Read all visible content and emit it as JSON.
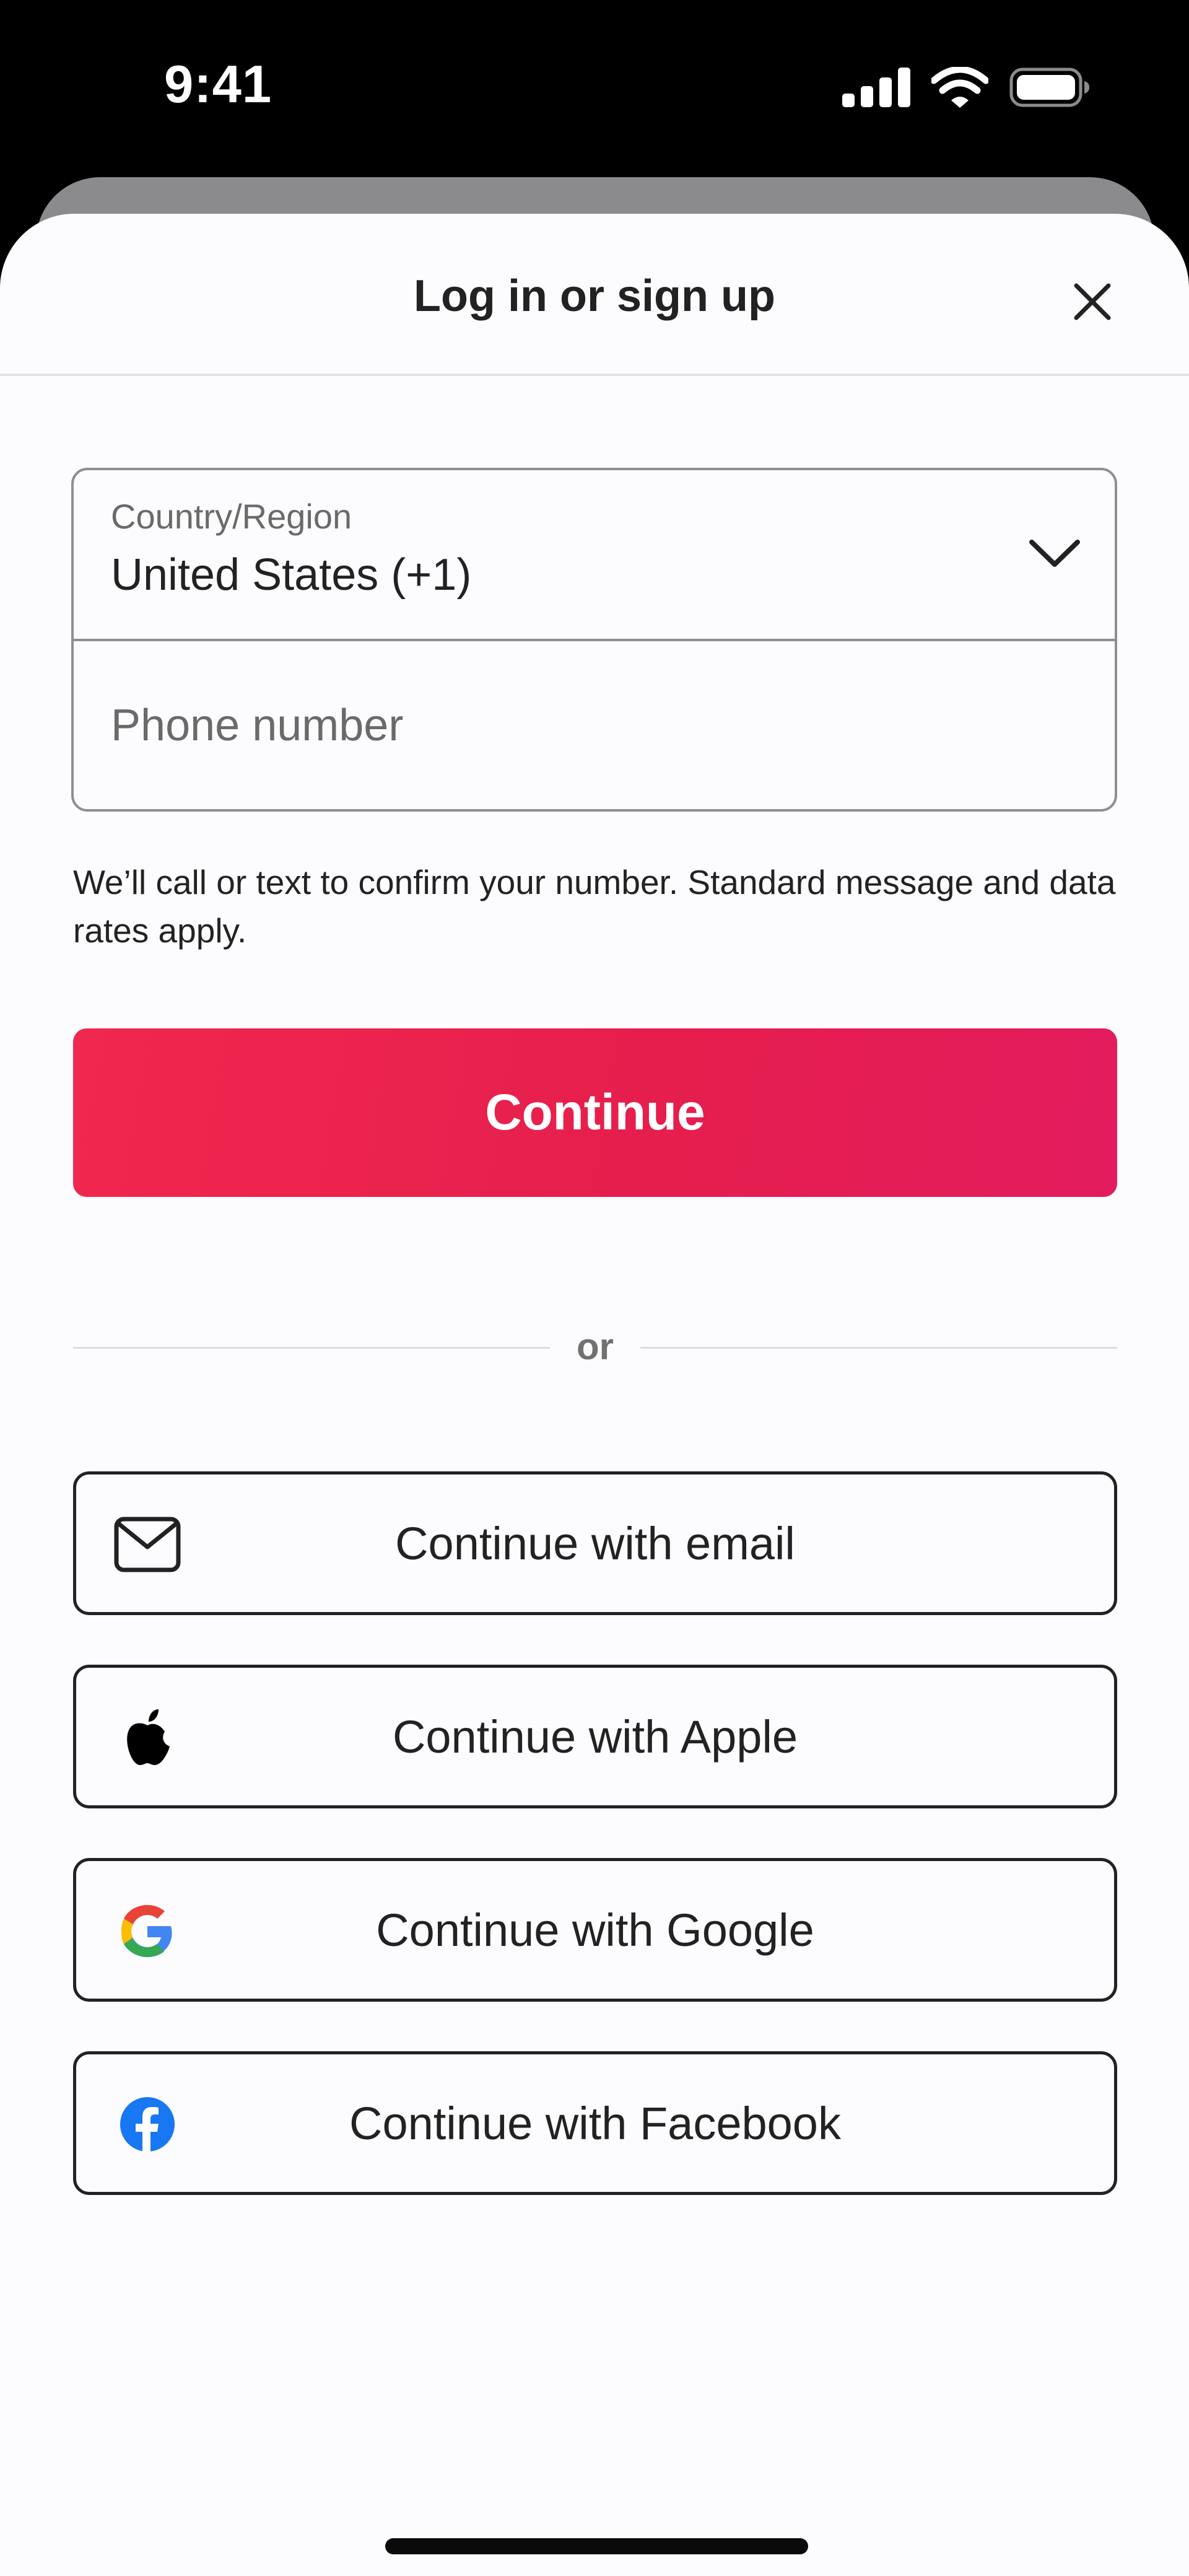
{
  "status_bar": {
    "time": "9:41",
    "icons": [
      "cellular-signal-icon",
      "wifi-icon",
      "battery-icon"
    ]
  },
  "sheet": {
    "title": "Log in or sign up",
    "close_icon": "close-icon"
  },
  "form": {
    "country_label": "Country/Region",
    "country_value": "United States (+1)",
    "phone_placeholder": "Phone number",
    "phone_value": ""
  },
  "helper_text": "We’ll call or text to confirm your number. Standard message and data rates apply.",
  "continue_label": "Continue",
  "divider_text": "or",
  "social_buttons": [
    {
      "label": "Continue with email",
      "icon": "mail-icon"
    },
    {
      "label": "Continue with Apple",
      "icon": "apple-logo-icon"
    },
    {
      "label": "Continue with Google",
      "icon": "google-logo-icon"
    },
    {
      "label": "Continue with Facebook",
      "icon": "facebook-logo-icon"
    }
  ],
  "colors": {
    "brand": "#e61e4d",
    "text": "#222222",
    "muted": "#6a6a6a",
    "facebook": "#1877f2"
  }
}
